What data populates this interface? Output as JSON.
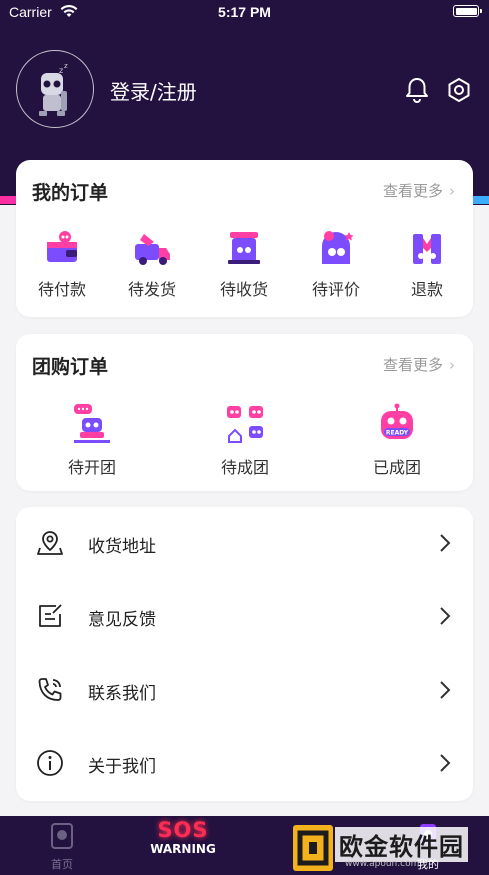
{
  "status_bar": {
    "carrier": "Carrier",
    "time": "5:17 PM"
  },
  "header": {
    "login_label": "登录/注册"
  },
  "my_orders": {
    "title": "我的订单",
    "more": "查看更多",
    "items": [
      {
        "label": "待付款",
        "icon": "wallet-robot-icon"
      },
      {
        "label": "待发货",
        "icon": "delivery-truck-icon"
      },
      {
        "label": "待收货",
        "icon": "package-box-icon"
      },
      {
        "label": "待评价",
        "icon": "review-house-icon"
      },
      {
        "label": "退款",
        "icon": "refund-icon"
      }
    ]
  },
  "group_orders": {
    "title": "团购订单",
    "more": "查看更多",
    "items": [
      {
        "label": "待开团",
        "icon": "chat-robot-icon"
      },
      {
        "label": "待成团",
        "icon": "robot-group-icon"
      },
      {
        "label": "已成团",
        "icon": "ready-robot-icon",
        "badge": "READY"
      }
    ]
  },
  "menu": [
    {
      "label": "收货地址",
      "icon": "location-icon"
    },
    {
      "label": "意见反馈",
      "icon": "feedback-icon"
    },
    {
      "label": "联系我们",
      "icon": "phone-icon"
    },
    {
      "label": "关于我们",
      "icon": "info-icon"
    }
  ],
  "tabbar": {
    "home_label": "首页",
    "sos_title": "SOS",
    "sos_subtitle": "WARNING",
    "mine_label": "我的"
  },
  "watermark": {
    "text": "欧金软件园",
    "url": "www.apoun.com"
  },
  "colors": {
    "header_bg": "#23123f",
    "accent_pink": "#ff2f9f",
    "accent_purple": "#8b3cff",
    "sos_red": "#ff2d55",
    "page_bg": "#f4f4f6"
  }
}
